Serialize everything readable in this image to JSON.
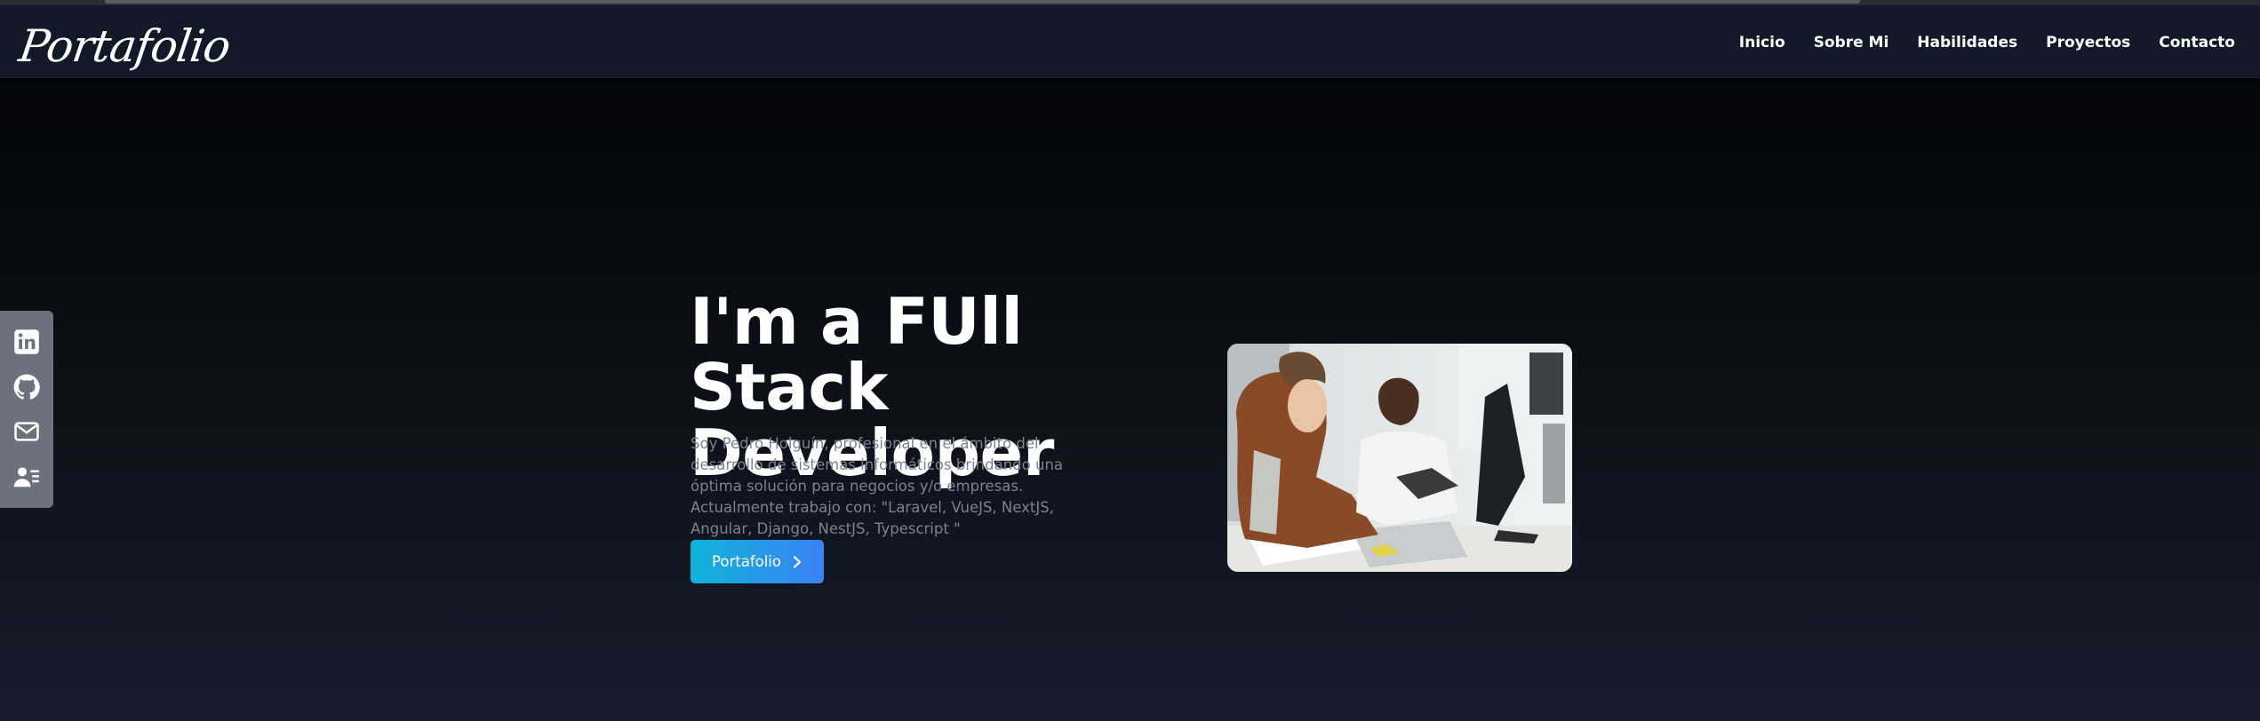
{
  "brand": {
    "logo_text": "Portafolio"
  },
  "nav": {
    "items": [
      {
        "label": "Inicio"
      },
      {
        "label": "Sobre Mi"
      },
      {
        "label": "Habilidades"
      },
      {
        "label": "Proyectos"
      },
      {
        "label": "Contacto"
      }
    ]
  },
  "social": {
    "items": [
      {
        "icon": "linkedin-icon"
      },
      {
        "icon": "github-icon"
      },
      {
        "icon": "mail-icon"
      },
      {
        "icon": "resume-icon"
      }
    ]
  },
  "hero": {
    "title_line1": "I'm a FUll Stack",
    "title_line2": "Developer",
    "description": "Soy Pedro Holguín, profesional en el ámbito del desarrollo de sistemas informáticos brindando una óptima solución para negocios y/o empresas. Actualmente trabajo con: \"Laravel, VueJS, NextJS, Angular, Django, NestJS, Typescript \"",
    "cta_label": "Portafolio"
  },
  "colors": {
    "navbar_bg": "#121a2a",
    "social_bar_bg": "#6b717d",
    "cta_gradient_start": "#0fb3d8",
    "cta_gradient_end": "#3b82f6",
    "description_text": "#7c8290"
  }
}
